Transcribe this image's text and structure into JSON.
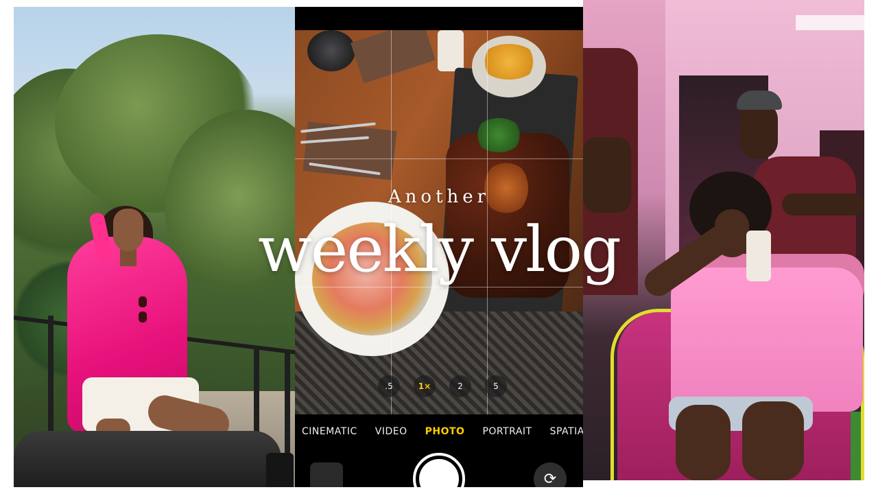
{
  "title": {
    "small": "Another",
    "big": "weekly vlog"
  },
  "camera": {
    "zoom_levels": [
      ".5",
      "1×",
      "2",
      "5"
    ],
    "active_zoom": "1×",
    "modes": [
      "CINEMATIC",
      "VIDEO",
      "PHOTO",
      "PORTRAIT",
      "SPATIAL"
    ],
    "active_mode": "PHOTO",
    "accent_color": "#ffcc00"
  },
  "icons": {
    "flip_camera": "flip-camera-icon"
  }
}
